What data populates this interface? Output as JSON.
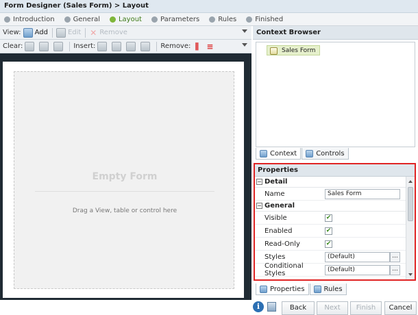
{
  "title": "Form Designer (Sales Form) > Layout",
  "steps": [
    "Introduction",
    "General",
    "Layout",
    "Parameters",
    "Rules",
    "Finished"
  ],
  "active_step": "Layout",
  "toolbar1": {
    "view_label": "View:",
    "add_label": "Add",
    "edit_label": "Edit",
    "remove_label": "Remove"
  },
  "toolbar2": {
    "clear_label": "Clear:",
    "insert_label": "Insert:",
    "remove_label": "Remove:"
  },
  "canvas": {
    "empty_title": "Empty Form",
    "hint": "Drag a View, table or control here"
  },
  "context_browser": {
    "header": "Context Browser",
    "tree_item": "Sales Form",
    "tabs": [
      "Context",
      "Controls"
    ]
  },
  "properties": {
    "header": "Properties",
    "sections": {
      "detail": "Detail",
      "general": "General"
    },
    "rows": {
      "name_label": "Name",
      "name_value": "Sales Form",
      "visible_label": "Visible",
      "enabled_label": "Enabled",
      "readonly_label": "Read-Only",
      "styles_label": "Styles",
      "styles_value": "(Default)",
      "cond_styles_label": "Conditional Styles",
      "cond_styles_value": "(Default)",
      "ellipsis": "..."
    },
    "checks": {
      "visible": true,
      "enabled": true,
      "readonly": true
    },
    "tabs": [
      "Properties",
      "Rules"
    ]
  },
  "footer": {
    "info_icon_glyph": "i",
    "buttons": [
      "Back",
      "Next",
      "Finish",
      "Cancel"
    ]
  },
  "colors": {
    "accent_active": "#7fb63a",
    "highlight_border": "#e02424"
  }
}
